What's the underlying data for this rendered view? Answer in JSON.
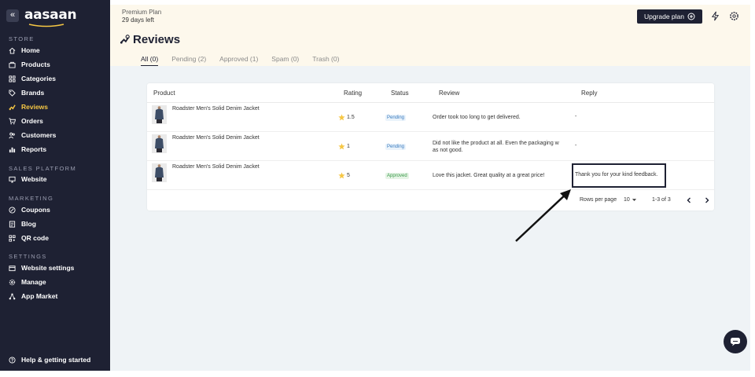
{
  "sidebar": {
    "logo": "aasaan",
    "sections": {
      "store": "STORE",
      "sales_platform": "SALES PLATFORM",
      "marketing": "MARKETING",
      "settings": "SETTINGS"
    },
    "items": {
      "home": "Home",
      "products": "Products",
      "categories": "Categories",
      "brands": "Brands",
      "reviews": "Reviews",
      "orders": "Orders",
      "customers": "Customers",
      "reports": "Reports",
      "website": "Website",
      "coupons": "Coupons",
      "blog": "Blog",
      "qr_code": "QR code",
      "website_settings": "Website settings",
      "manage": "Manage",
      "app_market": "App Market",
      "help": "Help & getting started"
    },
    "accent_color": "#f6c744"
  },
  "topbar": {
    "plan_name": "Premium Plan",
    "plan_days": "29 days left",
    "upgrade_label": "Upgrade plan"
  },
  "page": {
    "title": "Reviews",
    "tabs": [
      "All (0)",
      "Pending (2)",
      "Approved (1)",
      "Spam (0)",
      "Trash (0)"
    ]
  },
  "table": {
    "headers": {
      "product": "Product",
      "rating": "Rating",
      "status": "Status",
      "review": "Review",
      "reply": "Reply"
    },
    "rows": [
      {
        "product": "Roadster Men's Solid Denim Jacket",
        "rating": "1.5",
        "status": "Pending",
        "review_line1": "Order took too long to get delivered.",
        "review_line2": "",
        "reply": "-"
      },
      {
        "product": "Roadster Men's Solid Denim Jacket",
        "rating": "1",
        "status": "Pending",
        "review_line1": "Did not like the product at all. Even the packaging w",
        "review_line2": "as not good.",
        "reply": "-"
      },
      {
        "product": "Roadster Men's Solid Denim Jacket",
        "rating": "5",
        "status": "Approved",
        "review_line1": "Love this jacket. Great quality at a great price!",
        "review_line2": "",
        "reply": "Thank you for your kind feedback."
      }
    ],
    "pagination": {
      "rows_per_page_label": "Rows per page",
      "rows_per_page_value": "10",
      "range": "1-3 of 3"
    }
  }
}
